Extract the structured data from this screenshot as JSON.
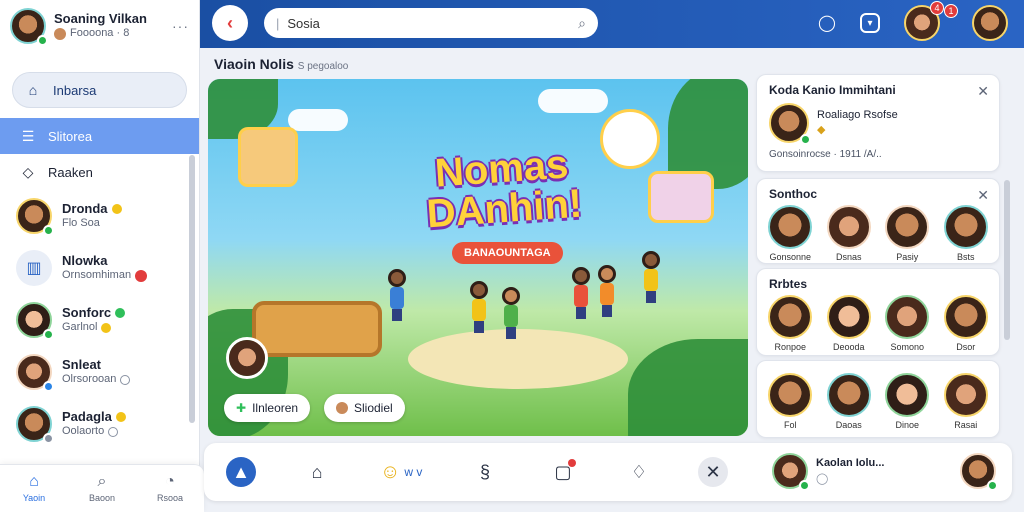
{
  "profile": {
    "name": "Soaning Vilkan",
    "status": "Foooona · 8",
    "more": "···"
  },
  "sidebar": {
    "items": [
      {
        "label": "Inbarsa",
        "icon": "home-icon"
      },
      {
        "label": "Slitorea",
        "icon": "list-icon"
      },
      {
        "label": "Raaken",
        "icon": "tag-icon"
      }
    ],
    "contacts": [
      {
        "name": "Dronda",
        "sub": "Flo Soa"
      },
      {
        "name": "Nlowka",
        "sub": "Ornsomhiman"
      },
      {
        "name": "Sonforc",
        "sub": "Garlnol"
      },
      {
        "name": "Snleat",
        "sub": "Olrsorooan"
      },
      {
        "name": "Padagla",
        "sub": "Oolaorto"
      }
    ]
  },
  "bottom_nav": [
    {
      "label": "Yaoin",
      "icon": "home-icon"
    },
    {
      "label": "Baoon",
      "icon": "search-icon"
    },
    {
      "label": "Rsooa",
      "icon": "profile-icon"
    }
  ],
  "search": {
    "value": "Sosia",
    "placeholder": ""
  },
  "notifications": {
    "count_a": "4",
    "count_b": "1"
  },
  "section": {
    "title": "Viaoin Nolis",
    "hint": "S  pegoaloo"
  },
  "hero": {
    "title": "Nomas DAnhin!",
    "subtitle": "BANAOUNTAGA",
    "buttons": [
      {
        "label": "Ilnleoren"
      },
      {
        "label": "Sliodiel"
      }
    ]
  },
  "panels": {
    "invite": {
      "title": "Koda Kanio Immihtani",
      "name": "Roaliago Rsofse",
      "meta": "Gonsoinrocse · 1911 /A/.."
    },
    "suggest": {
      "title": "Sonthoc",
      "friends": [
        {
          "name": "Gonsonne"
        },
        {
          "name": "Dsnas"
        },
        {
          "name": "Pasiy"
        },
        {
          "name": "Bsts"
        }
      ]
    },
    "people": {
      "title": "Rrbtes",
      "friends": [
        {
          "name": "Ronpoe"
        },
        {
          "name": "Deooda"
        },
        {
          "name": "Somono"
        },
        {
          "name": "Dsor"
        }
      ]
    },
    "more": {
      "friends": [
        {
          "name": "Fol"
        },
        {
          "name": "Daoas"
        },
        {
          "name": "Dinoe"
        },
        {
          "name": "Rasai"
        }
      ]
    }
  },
  "bottombar": {
    "user_name": "Kaolan Iolu...",
    "emoji_label": "w v"
  },
  "colors": {
    "topbar": "#1a4fa3",
    "accent": "#6d9cf0",
    "alert": "#e23c3c",
    "online": "#26b24c"
  }
}
